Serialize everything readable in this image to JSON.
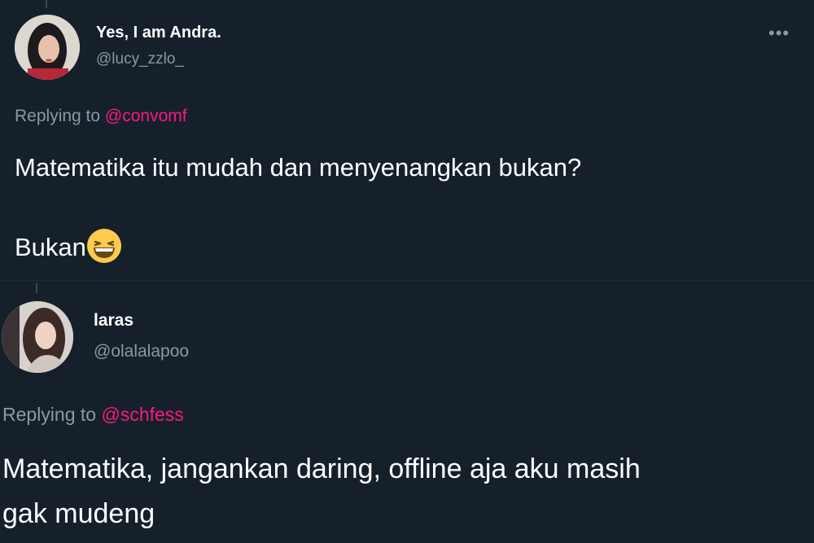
{
  "tweets": [
    {
      "display_name": "Yes, I am Andra.",
      "handle": "@lucy_zzlo_",
      "replying_prefix": "Replying to",
      "replying_to": "@convomf",
      "body_line1": "Matematika itu mudah dan menyenangkan bukan?",
      "body_line2": "Bukan",
      "emoji": "grinning-squinting-face",
      "more_icon": "more-horizontal-icon"
    },
    {
      "display_name": "laras",
      "handle": "@olalalapoo",
      "replying_prefix": "Replying to",
      "replying_to": "@schfess",
      "body_line1": "Matematika, jangankan daring, offline aja aku masih",
      "body_line2": "gak mudeng"
    }
  ],
  "colors": {
    "background": "#16202b",
    "text": "#ffffff",
    "muted": "#8b98a5",
    "mention": "#f91880"
  }
}
